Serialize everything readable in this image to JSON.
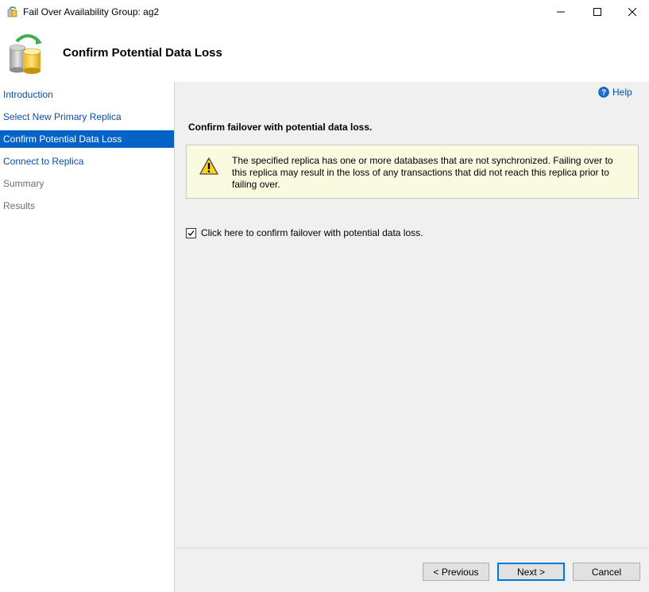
{
  "window": {
    "title": "Fail Over Availability Group: ag2",
    "minimize_glyph": "—",
    "maximize_glyph": "☐",
    "close_glyph": "✕"
  },
  "header": {
    "title": "Confirm Potential Data Loss"
  },
  "sidebar": {
    "items": [
      {
        "label": "Introduction",
        "state": "link"
      },
      {
        "label": "Select New Primary Replica",
        "state": "link"
      },
      {
        "label": "Confirm Potential Data Loss",
        "state": "active"
      },
      {
        "label": "Connect to Replica",
        "state": "link"
      },
      {
        "label": "Summary",
        "state": "disabled"
      },
      {
        "label": "Results",
        "state": "disabled"
      }
    ]
  },
  "main": {
    "help_label": "Help",
    "section_title": "Confirm failover with potential data loss.",
    "warning_text": "The specified replica has one or more databases that are not synchronized. Failing over to this replica may result in the loss of any transactions that did not reach this replica prior to failing over.",
    "confirm_checkbox": {
      "label": "Click here to confirm failover with potential data loss.",
      "checked": true
    }
  },
  "footer": {
    "previous_label": "< Previous",
    "next_label": "Next >",
    "cancel_label": "Cancel"
  },
  "colors": {
    "accent": "#0563c8",
    "link": "#0a4fa8",
    "warning_bg": "#fafae0"
  }
}
